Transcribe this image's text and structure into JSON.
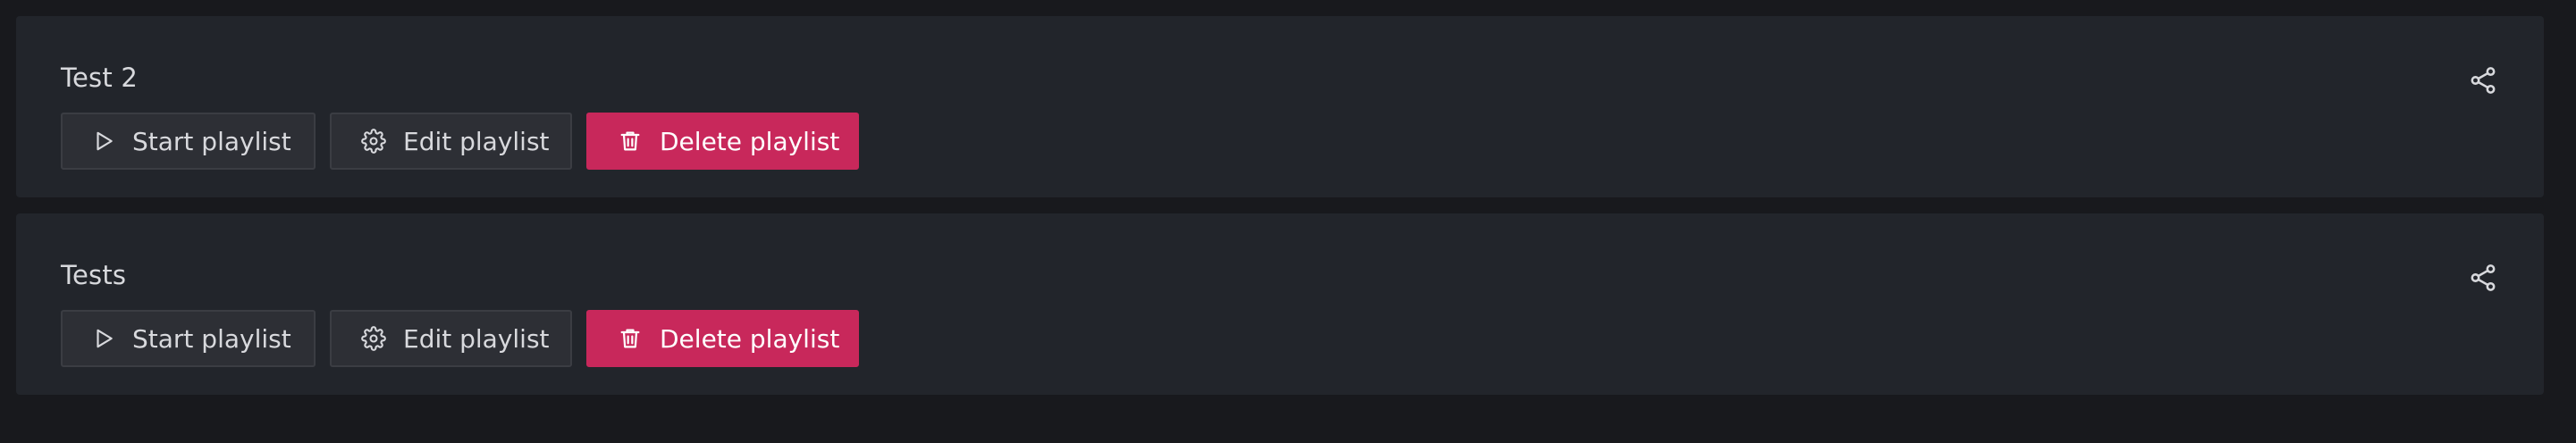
{
  "playlists": [
    {
      "title": "Test 2",
      "start_label": "Start playlist",
      "edit_label": "Edit playlist",
      "delete_label": "Delete playlist"
    },
    {
      "title": "Tests",
      "start_label": "Start playlist",
      "edit_label": "Edit playlist",
      "delete_label": "Delete playlist"
    }
  ],
  "icons": {
    "start": "play-icon",
    "edit": "gear-icon",
    "delete": "trash-icon",
    "share": "share-icon"
  },
  "colors": {
    "background": "#18191d",
    "card": "#22252b",
    "secondary_button": "#2d2f35",
    "danger": "#c8285b",
    "text": "#d8d9dd"
  }
}
